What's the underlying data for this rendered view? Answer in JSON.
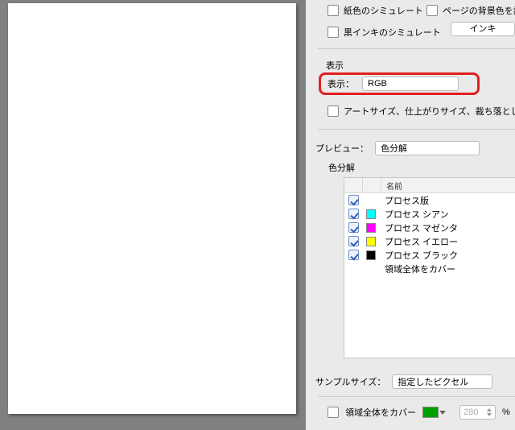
{
  "top": {
    "paper_sim": "紙色のシミュレート",
    "page_bg": "ページの背景色を設",
    "black_ink_sim": "黒インキのシミュレート",
    "ink_btn": "インキ"
  },
  "display": {
    "section": "表示",
    "label": "表示：",
    "value": "RGB",
    "artsize": "アートサイズ、仕上がりサイズ、裁ち落としサイ"
  },
  "preview": {
    "label": "プレビュー：",
    "value": "色分解"
  },
  "separations": {
    "title": "色分解",
    "name_header": "名前",
    "rows": [
      {
        "label": "プロセス版",
        "swatch": null,
        "checked": true
      },
      {
        "label": "プロセス シアン",
        "swatch": "#00ffff",
        "checked": true
      },
      {
        "label": "プロセス マゼンタ",
        "swatch": "#ff00ff",
        "checked": true
      },
      {
        "label": "プロセス イエロー",
        "swatch": "#ffff00",
        "checked": true
      },
      {
        "label": "プロセス ブラック",
        "swatch": "#000000",
        "checked": true
      },
      {
        "label": "領域全体をカバー",
        "swatch": null,
        "checked": false
      }
    ]
  },
  "sample": {
    "label": "サンプルサイズ：",
    "value": "指定したピクセル"
  },
  "coverage": {
    "label": "領域全体をカバー",
    "swatch": "#00a000",
    "value": "280",
    "unit": "%"
  }
}
